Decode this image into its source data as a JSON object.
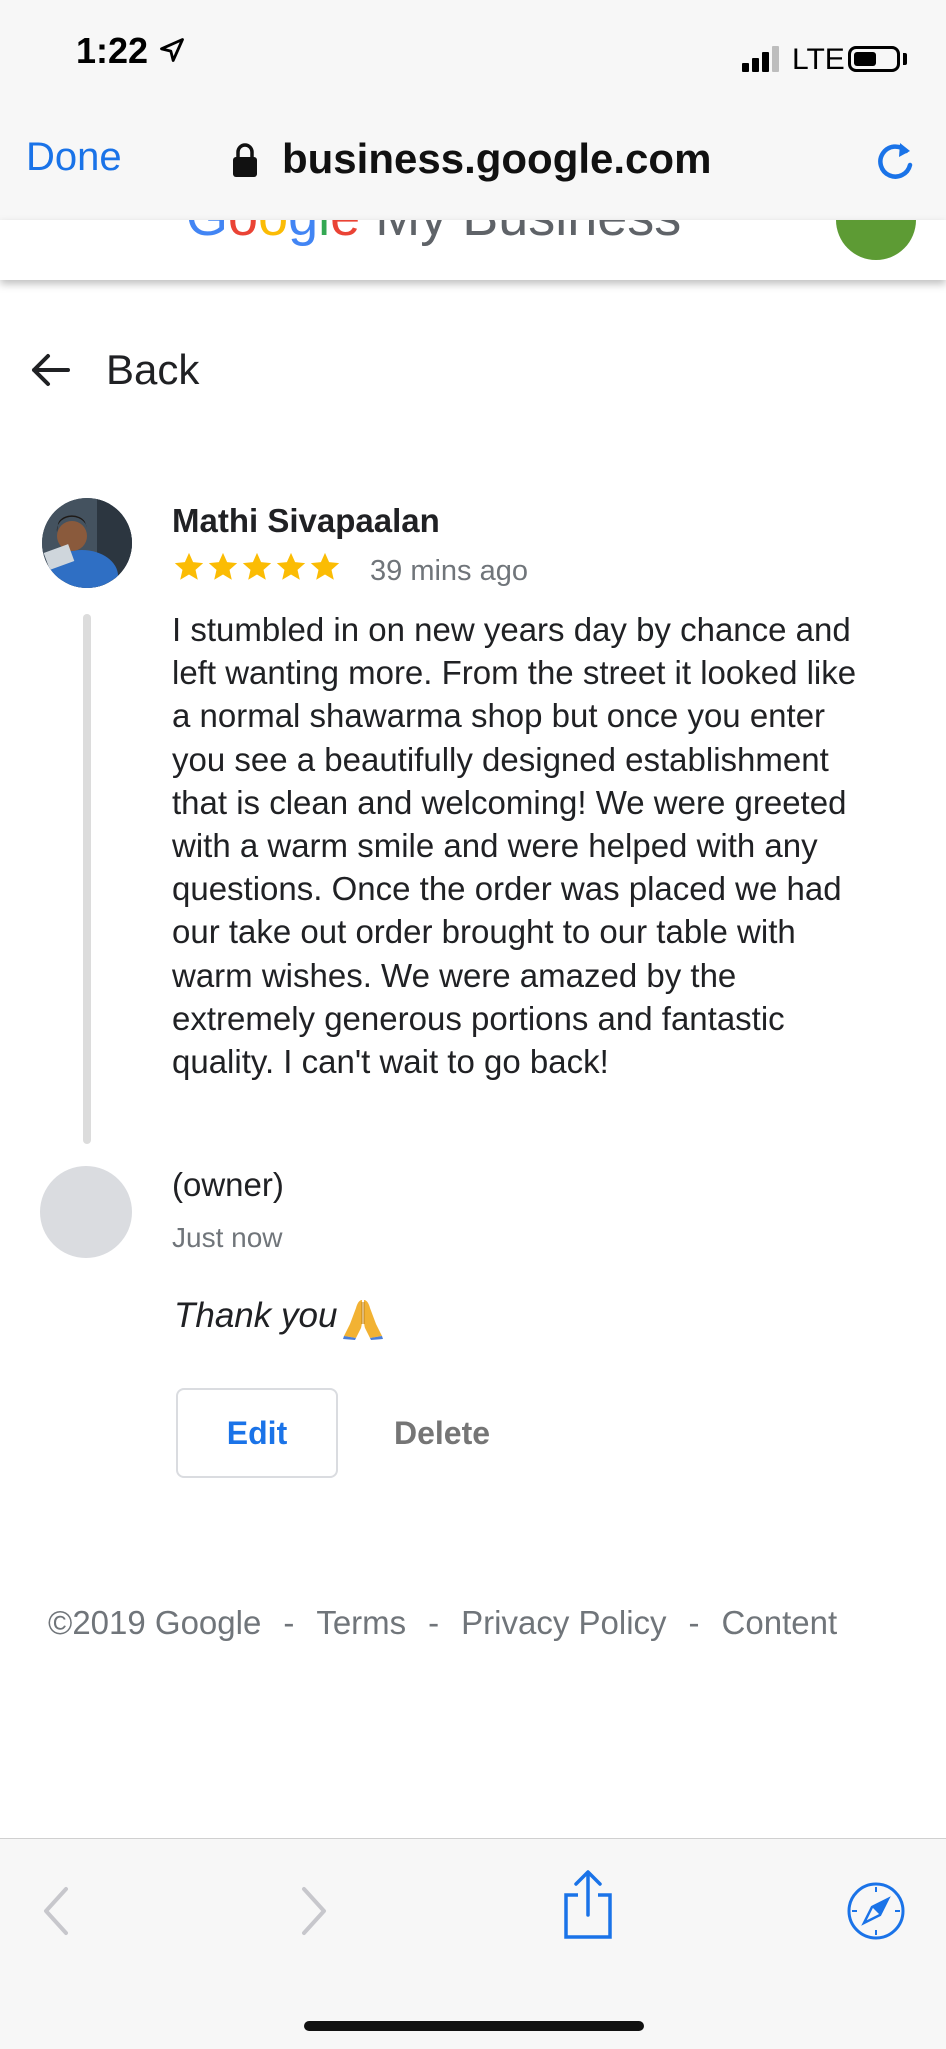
{
  "status_bar": {
    "time": "1:22",
    "carrier": "LTE"
  },
  "browser": {
    "done_label": "Done",
    "url": "business.google.com"
  },
  "page_header": {
    "brand_logo_text": "Google My Business"
  },
  "back": {
    "label": "Back"
  },
  "review": {
    "reviewer_name": "Mathi Sivapaalan",
    "rating": 5,
    "time": "39 mins ago",
    "text": "I stumbled in on new years day by chance and left wanting more. From the street it looked like a normal shawarma shop but once you enter you see a beautifully designed establishment that is clean and welcoming! We were greeted with a warm smile and were helped with any questions. Once the order was placed we had our take out order brought to our table with warm wishes. We were amazed by the extremely generous portions and fantastic quality. I can't wait to go back!"
  },
  "reply": {
    "author": "(owner)",
    "time": "Just now",
    "text": "Thank you",
    "emoji_icon": "folded-hands-icon",
    "edit_label": "Edit",
    "delete_label": "Delete"
  },
  "footer": {
    "copyright": "©2019 Google",
    "separator": "-",
    "links": [
      "Terms",
      "Privacy Policy",
      "Content"
    ]
  },
  "colors": {
    "accent_blue": "#1a73e8",
    "star_yellow": "#fbbc04",
    "muted_text": "#70757a"
  }
}
